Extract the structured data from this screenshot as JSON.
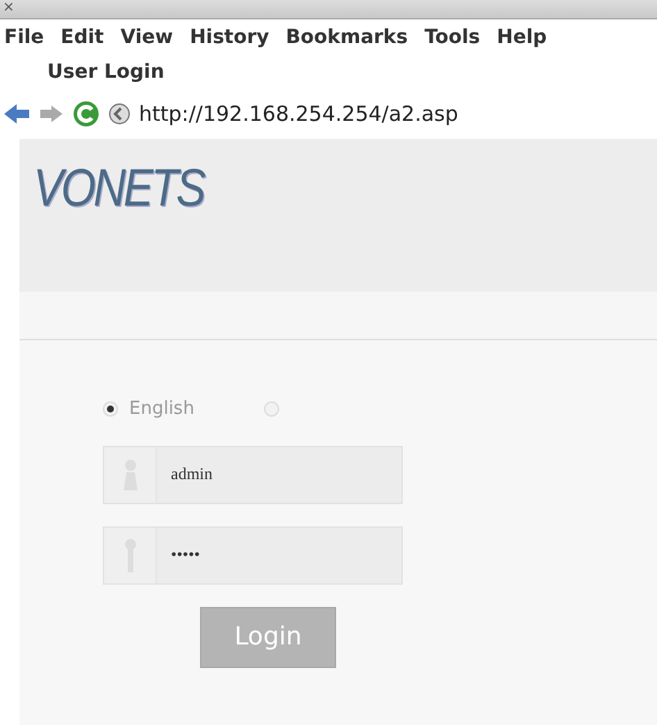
{
  "window": {
    "close_glyph": "×"
  },
  "menu": [
    "File",
    "Edit",
    "View",
    "History",
    "Bookmarks",
    "Tools",
    "Help"
  ],
  "tabs": [
    {
      "label": "User Login",
      "selected": true
    }
  ],
  "address_bar": {
    "url": "http://192.168.254.254/a2.asp"
  },
  "logo": {
    "text": "VONETS"
  },
  "language": [
    {
      "label": "English",
      "selected": true
    },
    {
      "selected": false
    }
  ],
  "username": {
    "value": "admin"
  },
  "password": {
    "value": "•••••"
  },
  "login_button": {
    "label": "Login",
    "disabled": true
  }
}
